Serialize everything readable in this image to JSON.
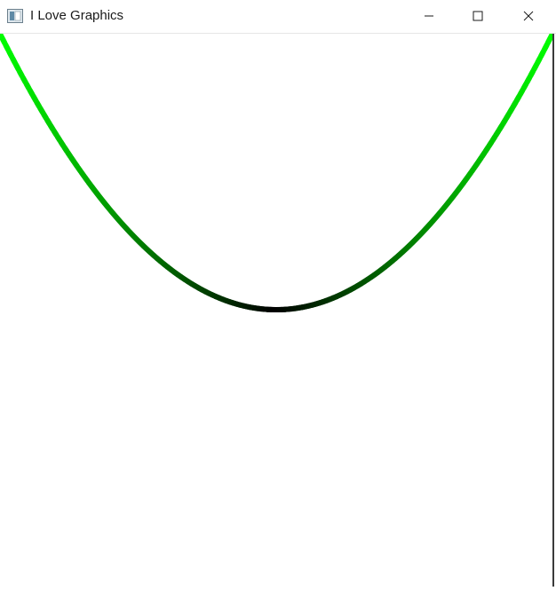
{
  "window": {
    "title": "I Love Graphics",
    "icon": "app-window-icon",
    "controls": [
      {
        "name": "minimize",
        "icon": "minimize-icon"
      },
      {
        "name": "maximize",
        "icon": "maximize-icon"
      },
      {
        "name": "close",
        "icon": "close-icon"
      }
    ]
  },
  "canvas": {
    "background": "#ffffff",
    "curve": {
      "shape": "parabola",
      "color_vertex": "#000000",
      "color_ends": "#00ff00"
    }
  }
}
